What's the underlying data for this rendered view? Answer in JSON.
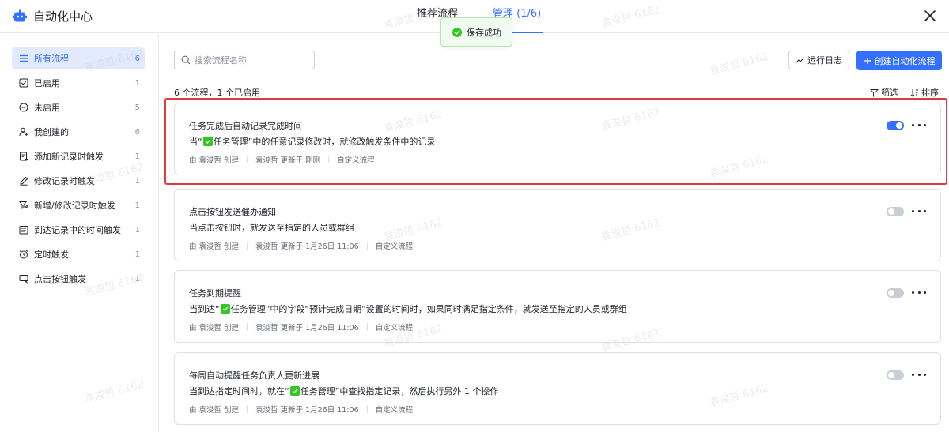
{
  "header": {
    "app_title": "自动化中心",
    "tabs": [
      {
        "label": "推荐流程",
        "active": false
      },
      {
        "label": "管理 (1/6)",
        "active": true
      }
    ]
  },
  "toast": {
    "text": "保存成功"
  },
  "sidebar": {
    "items": [
      {
        "label": "所有流程",
        "count": "6",
        "icon": "list-icon",
        "active": true
      },
      {
        "label": "已启用",
        "count": "1",
        "icon": "checkbox-icon",
        "active": false
      },
      {
        "label": "未启用",
        "count": "5",
        "icon": "minus-circle-icon",
        "active": false
      },
      {
        "label": "我创建的",
        "count": "6",
        "icon": "user-add-icon",
        "active": false
      },
      {
        "label": "添加新记录时触发",
        "count": "1",
        "icon": "add-record-icon",
        "active": false
      },
      {
        "label": "修改记录时触发",
        "count": "1",
        "icon": "edit-icon",
        "active": false
      },
      {
        "label": "新增/修改记录时触发",
        "count": "1",
        "icon": "filter-edit-icon",
        "active": false
      },
      {
        "label": "到达记录中的时间触发",
        "count": "1",
        "icon": "calendar-icon",
        "active": false
      },
      {
        "label": "定时触发",
        "count": "1",
        "icon": "alarm-clock-icon",
        "active": false
      },
      {
        "label": "点击按钮触发",
        "count": "1",
        "icon": "cursor-click-icon",
        "active": false
      }
    ]
  },
  "toolbar": {
    "search_placeholder": "搜索流程名称",
    "log_label": "运行日志",
    "create_label": "创建自动化流程",
    "filter_label": "筛选",
    "sort_label": "排序"
  },
  "summary": "6 个流程，1 个已启用",
  "flows": [
    {
      "title": "任务完成后自动记录完成时间",
      "desc_pre": "当“",
      "desc_table": "任务管理",
      "desc_post": "”中的任意记录修改时，就修改触发条件中的记录",
      "creator": "由 袁浚哲 创建",
      "updated": "袁浚哲 更新于 刚刚",
      "kind": "自定义流程",
      "enabled": true
    },
    {
      "title": "点击按钮发送催办通知",
      "desc_pre": "当点击按钮时，就发送至指定的人员或群组",
      "desc_table": "",
      "desc_post": "",
      "creator": "由 袁浚哲 创建",
      "updated": "袁浚哲 更新于 1月26日 11:06",
      "kind": "自定义流程",
      "enabled": false
    },
    {
      "title": "任务到期提醒",
      "desc_pre": "当到达“",
      "desc_table": "任务管理",
      "desc_post": "”中的字段“预计完成日期”设置的时间时，如果同时满足指定条件，就发送至指定的人员或群组",
      "creator": "由 袁浚哲 创建",
      "updated": "袁浚哲 更新于 1月26日 11:06",
      "kind": "自定义流程",
      "enabled": false
    },
    {
      "title": "每周自动提醒任务负责人更新进展",
      "desc_pre": "当到达指定时间时，就在“",
      "desc_table": "任务管理",
      "desc_post": "”中查找指定记录，然后执行另外 1 个操作",
      "creator": "由 袁浚哲 创建",
      "updated": "袁浚哲 更新于 1月26日 11:06",
      "kind": "自定义流程",
      "enabled": false
    }
  ],
  "watermark": "袁浚哲 6162",
  "colors": {
    "accent": "#3370ff",
    "success": "#34c724",
    "highlight": "#e03b3b"
  }
}
